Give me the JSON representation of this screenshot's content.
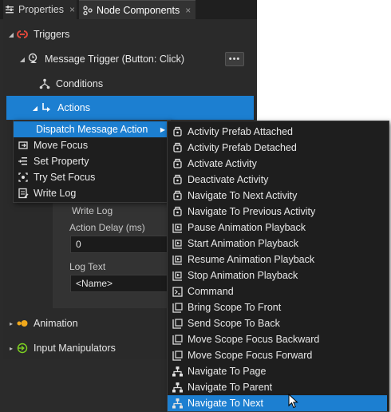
{
  "tabs": [
    {
      "label": "Properties",
      "close": "×"
    },
    {
      "label": "Node Components",
      "close": "×"
    }
  ],
  "tree": {
    "triggers": "Triggers",
    "message_trigger": "Message Trigger (Button: Click)",
    "more_button": "•••",
    "conditions": "Conditions",
    "actions": "Actions",
    "animation": "Animation",
    "input_manipulators": "Input Manipulators"
  },
  "properties": {
    "section": "Write Log",
    "action_delay_label": "Action Delay (ms)",
    "action_delay_value": "0",
    "log_text_label": "Log Text",
    "log_text_value": "<Name>"
  },
  "action_menu": {
    "items": [
      {
        "label": "Dispatch Message Action",
        "icon": "dispatch-message-icon",
        "highlighted": true,
        "has_submenu": true
      },
      {
        "label": "Move Focus",
        "icon": "move-focus-icon"
      },
      {
        "label": "Set Property",
        "icon": "set-property-icon"
      },
      {
        "label": "Try Set Focus",
        "icon": "try-set-focus-icon"
      },
      {
        "label": "Write Log",
        "icon": "write-log-icon"
      }
    ]
  },
  "submenu": {
    "items": [
      {
        "label": "Activity Prefab Attached",
        "icon": "activity-icon"
      },
      {
        "label": "Activity Prefab Detached",
        "icon": "activity-icon"
      },
      {
        "label": "Activate Activity",
        "icon": "activity-icon"
      },
      {
        "label": "Deactivate Activity",
        "icon": "activity-icon"
      },
      {
        "label": "Navigate To Next Activity",
        "icon": "activity-icon"
      },
      {
        "label": "Navigate To Previous Activity",
        "icon": "activity-icon"
      },
      {
        "label": "Pause Animation Playback",
        "icon": "animation-playback-icon"
      },
      {
        "label": "Start Animation Playback",
        "icon": "animation-playback-icon"
      },
      {
        "label": "Resume Animation Playback",
        "icon": "animation-playback-icon"
      },
      {
        "label": "Stop Animation Playback",
        "icon": "animation-playback-icon"
      },
      {
        "label": "Command",
        "icon": "command-icon"
      },
      {
        "label": "Bring Scope To Front",
        "icon": "scope-icon"
      },
      {
        "label": "Send Scope To Back",
        "icon": "scope-icon"
      },
      {
        "label": "Move Scope Focus Backward",
        "icon": "scope-icon"
      },
      {
        "label": "Move Scope Focus Forward",
        "icon": "scope-icon"
      },
      {
        "label": "Navigate To Page",
        "icon": "navigate-icon"
      },
      {
        "label": "Navigate To Parent",
        "icon": "navigate-icon"
      },
      {
        "label": "Navigate To Next",
        "icon": "navigate-icon",
        "highlighted": true
      }
    ]
  },
  "colors": {
    "accent": "#1c7fd1",
    "panel": "#2b2b2b",
    "menu": "#1e1e1e",
    "trigger_icon": "#e0483b",
    "animation_icon": "#f0a81c",
    "input_icon": "#7ed321"
  }
}
